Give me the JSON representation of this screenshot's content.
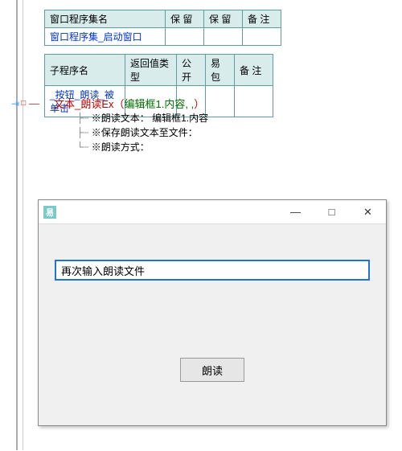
{
  "table1": {
    "headers": [
      "窗口程序集名",
      "保 留",
      "保 留",
      "备 注"
    ],
    "row": [
      "窗口程序集_启动窗口",
      "",
      "",
      ""
    ]
  },
  "table2": {
    "headers": [
      "子程序名",
      "返回值类型",
      "公开",
      "易包",
      "备 注"
    ],
    "row": [
      "_按钮_朗读_被单击",
      "",
      "",
      "",
      ""
    ]
  },
  "stmt": {
    "dash": "—",
    "fn": "文本_朗读Ex",
    "open": "（",
    "arg": "编辑框1.内容, , ",
    "close": "）"
  },
  "sub": {
    "l1_tree": "├┄",
    "l1": "※朗读文本：  编辑框1.内容",
    "l2_tree": "├┄",
    "l2": "※保存朗读文本至文件：",
    "l3_tree": "└┄",
    "l3": "※朗读方式："
  },
  "runtime": {
    "icon": "易",
    "title": "",
    "min": "—",
    "max": "□",
    "close": "✕",
    "input_value": "再次输入朗读文件",
    "button": "朗读"
  }
}
